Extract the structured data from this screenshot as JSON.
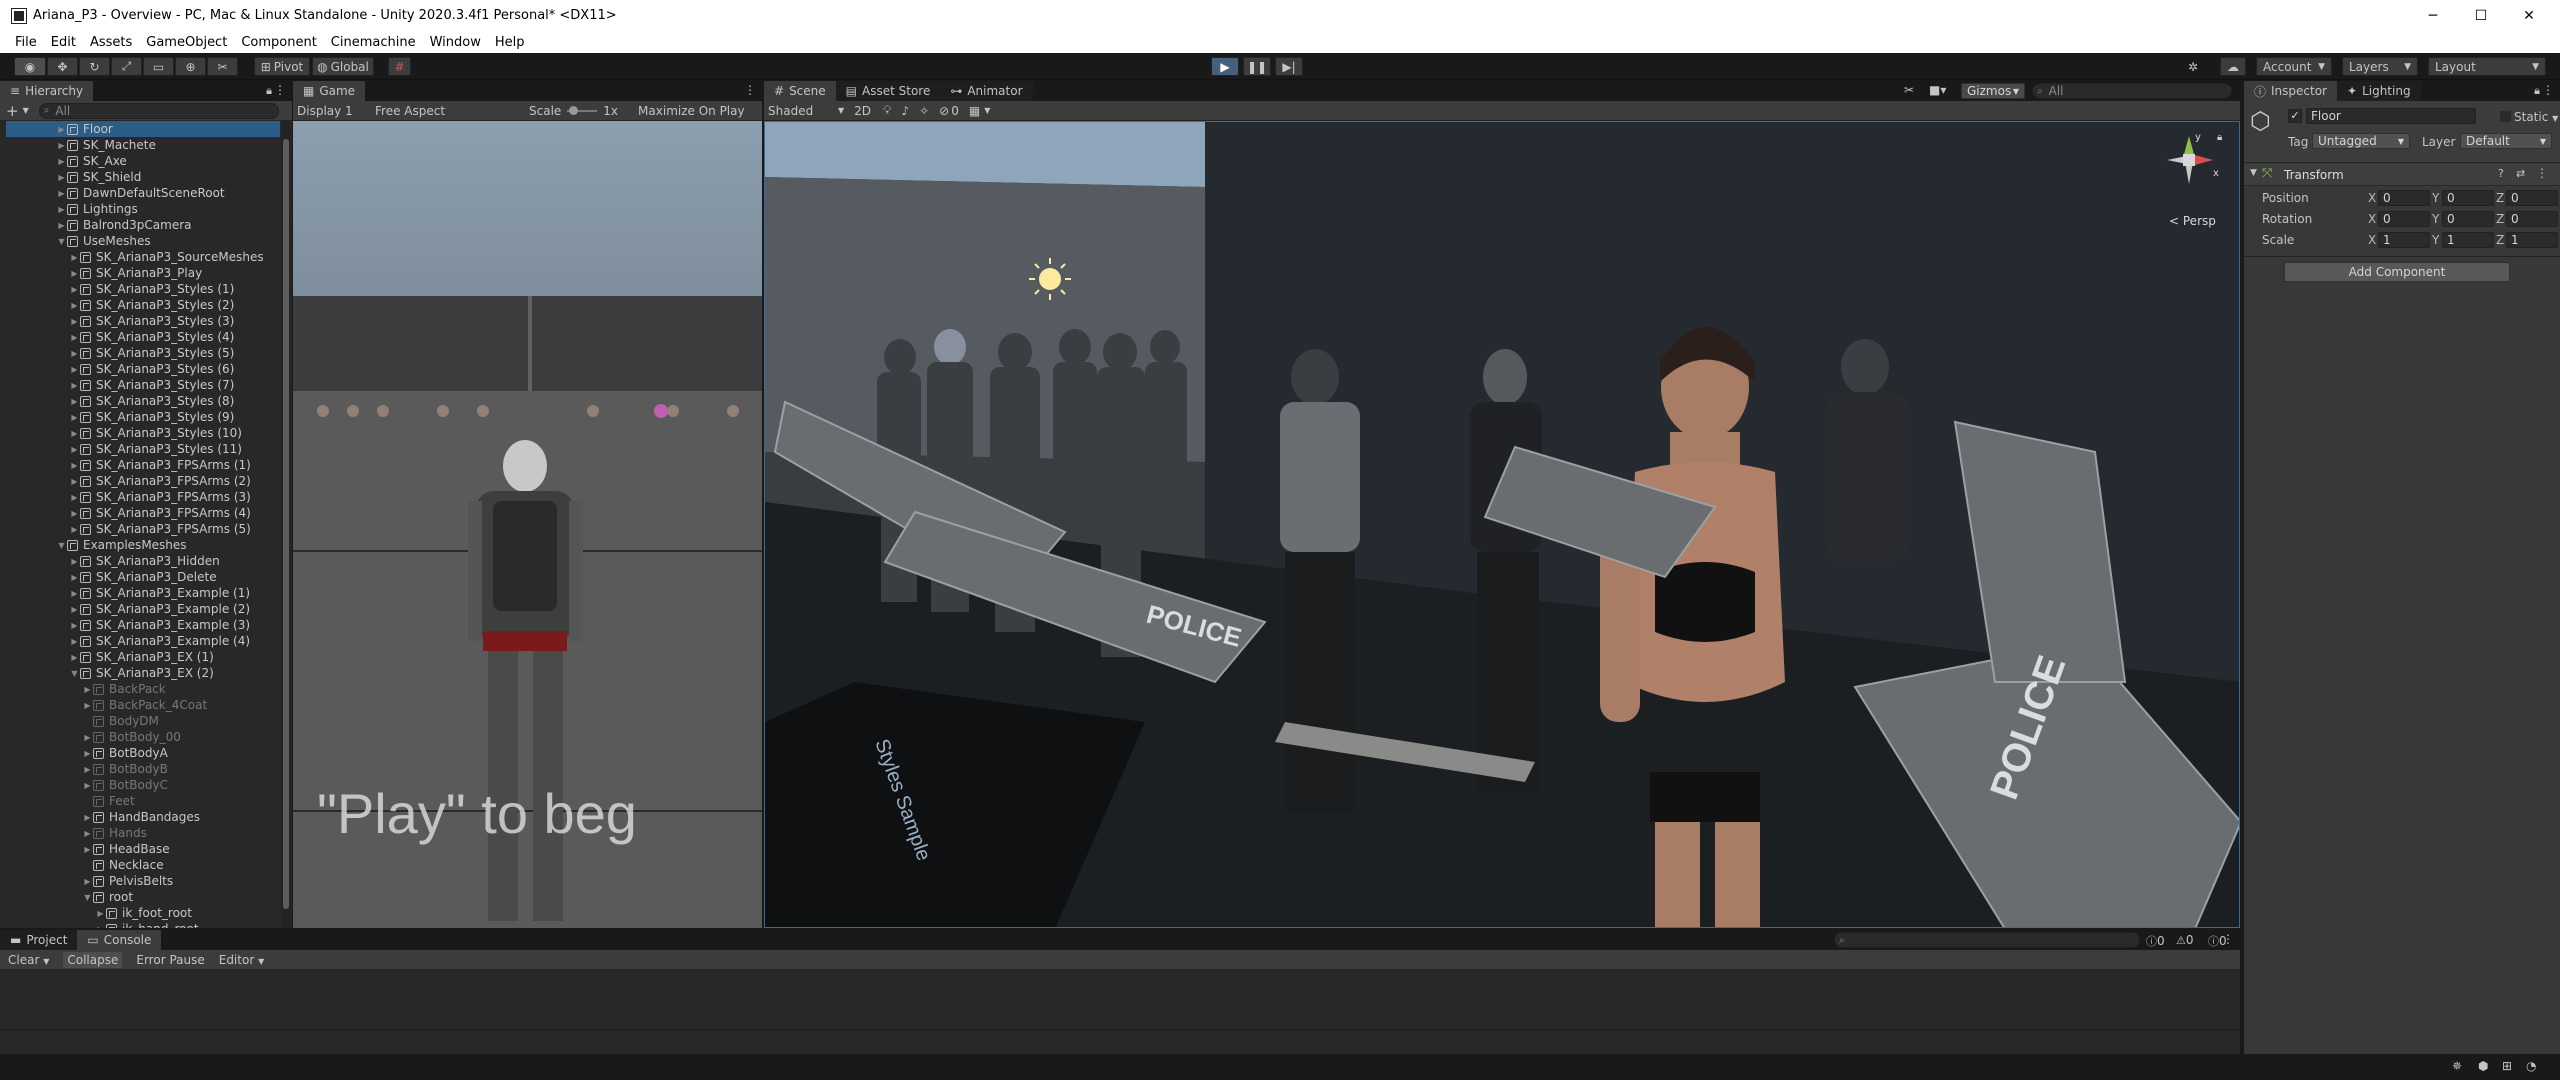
{
  "window": {
    "title": "Ariana_P3 - Overview - PC, Mac & Linux Standalone - Unity 2020.3.4f1 Personal* <DX11>",
    "minimize": "─",
    "maximize": "☐",
    "close": "✕"
  },
  "menu": [
    "File",
    "Edit",
    "Assets",
    "GameObject",
    "Component",
    "Cinemachine",
    "Window",
    "Help"
  ],
  "toolbar": {
    "pivot": "Pivot",
    "global": "Global",
    "account": "Account",
    "layers": "Layers",
    "layout": "Layout"
  },
  "hierarchy": {
    "tab": "Hierarchy",
    "search_placeholder": "All",
    "rows": [
      {
        "label": "Floor",
        "indent": 0,
        "arrow": "▶",
        "dim": false,
        "sel": true
      },
      {
        "label": "SK_Machete",
        "indent": 0,
        "arrow": "▶",
        "dim": false
      },
      {
        "label": "SK_Axe",
        "indent": 0,
        "arrow": "▶",
        "dim": false
      },
      {
        "label": "SK_Shield",
        "indent": 0,
        "arrow": "▶",
        "dim": false
      },
      {
        "label": "DawnDefaultSceneRoot",
        "indent": 0,
        "arrow": "▶",
        "dim": false
      },
      {
        "label": "Lightings",
        "indent": 0,
        "arrow": "▶",
        "dim": false
      },
      {
        "label": "Balrond3pCamera",
        "indent": 0,
        "arrow": "▶",
        "dim": false
      },
      {
        "label": "UseMeshes",
        "indent": 0,
        "arrow": "▼",
        "dim": false
      },
      {
        "label": "SK_ArianaP3_SourceMeshes",
        "indent": 1,
        "arrow": "▶",
        "dim": false
      },
      {
        "label": "SK_ArianaP3_Play",
        "indent": 1,
        "arrow": "▶",
        "dim": false
      },
      {
        "label": "SK_ArianaP3_Styles (1)",
        "indent": 1,
        "arrow": "▶",
        "dim": false
      },
      {
        "label": "SK_ArianaP3_Styles (2)",
        "indent": 1,
        "arrow": "▶",
        "dim": false
      },
      {
        "label": "SK_ArianaP3_Styles (3)",
        "indent": 1,
        "arrow": "▶",
        "dim": false
      },
      {
        "label": "SK_ArianaP3_Styles (4)",
        "indent": 1,
        "arrow": "▶",
        "dim": false
      },
      {
        "label": "SK_ArianaP3_Styles (5)",
        "indent": 1,
        "arrow": "▶",
        "dim": false
      },
      {
        "label": "SK_ArianaP3_Styles (6)",
        "indent": 1,
        "arrow": "▶",
        "dim": false
      },
      {
        "label": "SK_ArianaP3_Styles (7)",
        "indent": 1,
        "arrow": "▶",
        "dim": false
      },
      {
        "label": "SK_ArianaP3_Styles (8)",
        "indent": 1,
        "arrow": "▶",
        "dim": false
      },
      {
        "label": "SK_ArianaP3_Styles (9)",
        "indent": 1,
        "arrow": "▶",
        "dim": false
      },
      {
        "label": "SK_ArianaP3_Styles (10)",
        "indent": 1,
        "arrow": "▶",
        "dim": false
      },
      {
        "label": "SK_ArianaP3_Styles (11)",
        "indent": 1,
        "arrow": "▶",
        "dim": false
      },
      {
        "label": "SK_ArianaP3_FPSArms (1)",
        "indent": 1,
        "arrow": "▶",
        "dim": false
      },
      {
        "label": "SK_ArianaP3_FPSArms (2)",
        "indent": 1,
        "arrow": "▶",
        "dim": false
      },
      {
        "label": "SK_ArianaP3_FPSArms (3)",
        "indent": 1,
        "arrow": "▶",
        "dim": false
      },
      {
        "label": "SK_ArianaP3_FPSArms (4)",
        "indent": 1,
        "arrow": "▶",
        "dim": false
      },
      {
        "label": "SK_ArianaP3_FPSArms (5)",
        "indent": 1,
        "arrow": "▶",
        "dim": false
      },
      {
        "label": "ExamplesMeshes",
        "indent": 0,
        "arrow": "▼",
        "dim": false
      },
      {
        "label": "SK_ArianaP3_Hidden",
        "indent": 1,
        "arrow": "▶",
        "dim": false
      },
      {
        "label": "SK_ArianaP3_Delete",
        "indent": 1,
        "arrow": "▶",
        "dim": false
      },
      {
        "label": "SK_ArianaP3_Example (1)",
        "indent": 1,
        "arrow": "▶",
        "dim": false
      },
      {
        "label": "SK_ArianaP3_Example (2)",
        "indent": 1,
        "arrow": "▶",
        "dim": false
      },
      {
        "label": "SK_ArianaP3_Example (3)",
        "indent": 1,
        "arrow": "▶",
        "dim": false
      },
      {
        "label": "SK_ArianaP3_Example (4)",
        "indent": 1,
        "arrow": "▶",
        "dim": false
      },
      {
        "label": "SK_ArianaP3_EX (1)",
        "indent": 1,
        "arrow": "▶",
        "dim": false
      },
      {
        "label": "SK_ArianaP3_EX (2)",
        "indent": 1,
        "arrow": "▼",
        "dim": false
      },
      {
        "label": "BackPack",
        "indent": 2,
        "arrow": "▶",
        "dim": true
      },
      {
        "label": "BackPack_4Coat",
        "indent": 2,
        "arrow": "▶",
        "dim": true
      },
      {
        "label": "BodyDM",
        "indent": 2,
        "arrow": "",
        "dim": true
      },
      {
        "label": "BotBody_00",
        "indent": 2,
        "arrow": "▶",
        "dim": true
      },
      {
        "label": "BotBodyA",
        "indent": 2,
        "arrow": "▶",
        "dim": false
      },
      {
        "label": "BotBodyB",
        "indent": 2,
        "arrow": "▶",
        "dim": true
      },
      {
        "label": "BotBodyC",
        "indent": 2,
        "arrow": "▶",
        "dim": true
      },
      {
        "label": "Feet",
        "indent": 2,
        "arrow": "",
        "dim": true
      },
      {
        "label": "HandBandages",
        "indent": 2,
        "arrow": "▶",
        "dim": false
      },
      {
        "label": "Hands",
        "indent": 2,
        "arrow": "▶",
        "dim": true
      },
      {
        "label": "HeadBase",
        "indent": 2,
        "arrow": "▶",
        "dim": false
      },
      {
        "label": "Necklace",
        "indent": 2,
        "arrow": "",
        "dim": false
      },
      {
        "label": "PelvisBelts",
        "indent": 2,
        "arrow": "▶",
        "dim": false
      },
      {
        "label": "root",
        "indent": 2,
        "arrow": "▼",
        "dim": false
      },
      {
        "label": "ik_foot_root",
        "indent": 3,
        "arrow": "▶",
        "dim": false
      },
      {
        "label": "ik_hand_root",
        "indent": 3,
        "arrow": "▶",
        "dim": false
      }
    ]
  },
  "game": {
    "tab": "Game",
    "display": "Display 1",
    "aspect": "Free Aspect",
    "scale_label": "Scale",
    "scale_value": "1x",
    "maximize": "Maximize On Play",
    "overlay_text": "\"Play\" to beg"
  },
  "scene": {
    "tab": "Scene",
    "asset_store": "Asset Store",
    "animator": "Animator",
    "shading": "Shaded",
    "mode2d": "2D",
    "hidden_count": "0",
    "gizmos": "Gizmos",
    "search_placeholder": "All",
    "persp": "Persp",
    "axis_y": "y",
    "axis_x": "x",
    "floor_text": "Styles Sample",
    "shield_text": "POLICE"
  },
  "inspector": {
    "tab": "Inspector",
    "lighting_tab": "Lighting",
    "object_name": "Floor",
    "static": "Static",
    "tag_label": "Tag",
    "tag_value": "Untagged",
    "layer_label": "Layer",
    "layer_value": "Default",
    "component": "Transform",
    "rows": [
      {
        "label": "Position",
        "x": "0",
        "y": "0",
        "z": "0"
      },
      {
        "label": "Rotation",
        "x": "0",
        "y": "0",
        "z": "0"
      },
      {
        "label": "Scale",
        "x": "1",
        "y": "1",
        "z": "1"
      }
    ],
    "axis": {
      "x": "X",
      "y": "Y",
      "z": "Z"
    },
    "add_component": "Add Component"
  },
  "console": {
    "project_tab": "Project",
    "console_tab": "Console",
    "clear": "Clear",
    "collapse": "Collapse",
    "error_pause": "Error Pause",
    "editor": "Editor",
    "count_log": "0",
    "count_warn": "0",
    "count_err": "0"
  },
  "colors": {
    "accent": "#2c5d87",
    "play": "#46607c",
    "selection": "#2c5d87"
  }
}
